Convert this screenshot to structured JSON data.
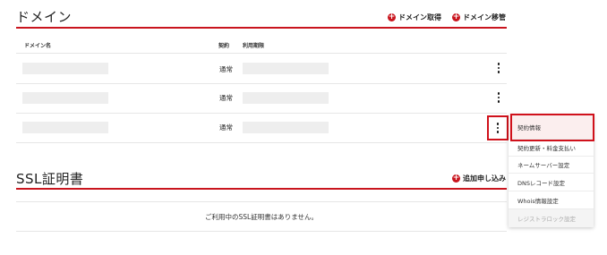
{
  "domain_section": {
    "title": "ドメイン",
    "actions": [
      {
        "label": "ドメイン取得"
      },
      {
        "label": "ドメイン移管"
      }
    ],
    "table": {
      "headers": {
        "name": "ドメイン名",
        "contract": "契約",
        "expiry": "利用期限"
      },
      "rows": [
        {
          "contract": "通常"
        },
        {
          "contract": "通常"
        },
        {
          "contract": "通常"
        }
      ]
    }
  },
  "context_menu": {
    "items": [
      {
        "label": "契約情報"
      },
      {
        "label": "契約更新・料金支払い"
      },
      {
        "label": "ネームサーバー設定"
      },
      {
        "label": "DNSレコード設定"
      },
      {
        "label": "Whois情報設定"
      },
      {
        "label": "レジストラロック設定"
      }
    ]
  },
  "ssl_section": {
    "title": "SSL証明書",
    "action": {
      "label": "追加申し込み"
    },
    "empty_message": "ご利用中のSSL証明書はありません。"
  },
  "colors": {
    "accent": "#c9151e",
    "placeholder": "#eeeeee"
  }
}
